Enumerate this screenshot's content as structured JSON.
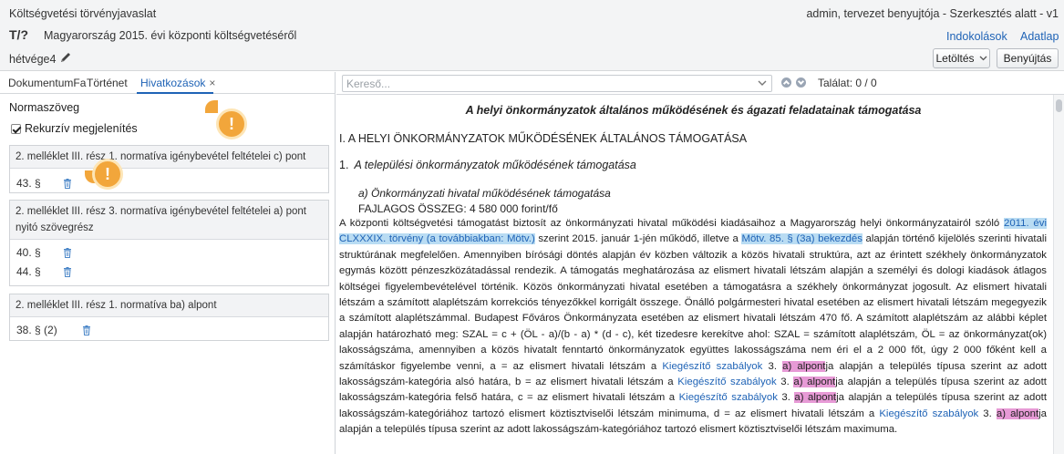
{
  "header": {
    "app_title": "Költségvetési törvényjavaslat",
    "user_info": "admin, tervezet benyujtója - Szerkesztés alatt - v1",
    "doc_id": "T/?",
    "doc_title": "Magyarország 2015. évi központi költségvetéséről",
    "links": {
      "reasons": "Indokolások",
      "datasheet": "Adatlap"
    },
    "version_label": "hétvége4",
    "download_label": "Letöltés",
    "submit_label": "Benyújtás"
  },
  "left": {
    "tabs": {
      "tree": "DokumentumFa",
      "history": "Történet",
      "references": "Hivatkozások"
    },
    "section_label": "Normaszöveg",
    "recursive_label": "Rekurzív megjelenítés",
    "groups": [
      {
        "title": "2. melléklet III. rész 1. normatíva igénybevétel feltételei c) pont",
        "items": [
          "43. §"
        ]
      },
      {
        "title": "2. melléklet III. rész 3. normatíva igénybevétel feltételei a) pont nyitó szövegrész",
        "items": [
          "40. §",
          "44. §"
        ]
      },
      {
        "title": "2. melléklet III. rész 1. normatíva ba) alpont",
        "items": [
          "38. § (2)"
        ]
      }
    ],
    "warning_glyph": "!"
  },
  "right": {
    "search_placeholder": "Kereső...",
    "found_label": "Találat: 0 / 0",
    "doc": {
      "main_title": "A helyi önkormányzatok általános működésének és ágazati feladatainak támogatása",
      "heading1": "I. A HELYI ÖNKORMÁNYZATOK MŰKÖDÉSÉNEK ÁLTALÁNOS TÁMOGATÁSA",
      "heading2_num": "1.",
      "heading2_text": "A települési önkormányzatok működésének támogatása",
      "heading3": "a) Önkormányzati hivatal működésének támogatása",
      "sum": "FAJLAGOS ÖSSZEG: 4 580 000 forint/fő",
      "body": {
        "p1": "A központi költségvetési támogatást biztosít az önkormányzati hivatal működési kiadásaihoz a Magyarország helyi önkormányzatairól szóló ",
        "hl1": "2011. évi CLXXXIX. törvény (a továbbiakban: Mötv.)",
        "p2": " szerint 2015. január 1-jén működő, illetve a ",
        "hl2": "Mötv. 85. § (3a) bekezdés",
        "p3": " alapján történő kijelölés szerinti hivatali struktúrának megfelelően. Amennyiben bírósági döntés alapján év közben változik a közös hivatali struktúra, azt az érintett székhely önkormányzatok egymás között pénzeszközátadással rendezik. A támogatás meghatározása az elismert hivatali létszám alapján a személyi és dologi kiadások átlagos költségei figyelembevételével történik. Közös önkormányzati hivatal esetében a támogatásra a székhely önkormányzat jogosult. Az elismert hivatali létszám a számított alaplétszám korrekciós tényezőkkel korrigált összege. Önálló polgármesteri hivatal esetében az elismert hivatali létszám megegyezik a számított alaplétszámmal. Budapest Főváros Önkormányzata esetében az elismert hivatali létszám 470 fő. A számított alaplétszám az alábbi képlet alapján határozható meg: SZAL = c + (ÖL - a)/(b - a) * (d - c), két tizedesre kerekítve ahol: SZAL = számított alaplétszám, ÖL = az önkormányzat(ok) lakosságszáma, amennyiben a közös hivatalt fenntartó önkormányzatok együttes lakosságszáma nem éri el a 2 000 főt, úgy 2 000 főként kell a számításkor figyelembe venni, a = az elismert hivatali létszám a ",
        "lnk": "Kiegészítő szabályok",
        "num": " 3. ",
        "pink": "a) alpont",
        "p4a": "ja alapján a település típusa szerint az adott lakosságszám-kategória alsó határa, b = az elismert hivatali létszám a ",
        "p4b": "ja alapján a település típusa szerint az adott lakosságszám-kategória felső határa, c = az elismert hivatali létszám a ",
        "p4c": "ja alapján a település típusa szerint az adott lakosságszám-kategóriához tartozó elismert köztisztviselői létszám minimuma, d = az elismert hivatali létszám a ",
        "p4d": "ja alapján a település típusa szerint az adott lakosságszám-kategóriához tartozó elismert köztisztviselői létszám maximuma."
      }
    }
  }
}
